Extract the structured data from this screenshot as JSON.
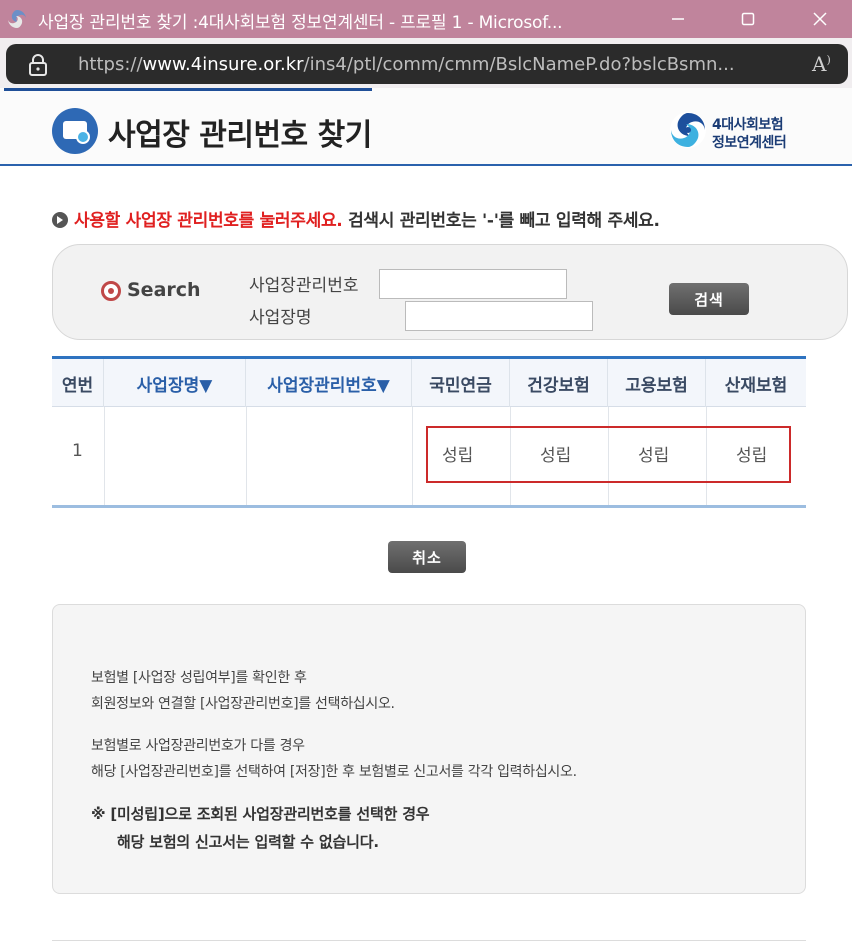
{
  "window": {
    "title": "사업장 관리번호 찾기 :4대사회보험 정보연계센터 - 프로필 1 - Microsof...",
    "url_prefix": "https://",
    "url_domain": "www.4insure.or.kr",
    "url_path": "/ins4/ptl/comm/cmm/BslcNameP.do?bslcBsmn..."
  },
  "header": {
    "page_title": "사업장 관리번호 찾기",
    "brand_line1": "4대사회보험",
    "brand_line2": "정보연계센터"
  },
  "notice": {
    "red_text": "사용할 사업장 관리번호를 눌러주세요.",
    "black_text": " 검색시 관리번호는 '-'를 빼고 입력해 주세요."
  },
  "search": {
    "label": "Search",
    "field1_label": "사업장관리번호",
    "field1_value": "",
    "field2_label": "사업장명",
    "field2_value": "",
    "button_label": "검색"
  },
  "table": {
    "headers": [
      "연번",
      "사업장명▼",
      "사업장관리번호▼",
      "국민연금",
      "건강보험",
      "고용보험",
      "산재보험"
    ],
    "rows": [
      [
        "1",
        "",
        "",
        "성립",
        "성립",
        "성립",
        "성립"
      ]
    ]
  },
  "cancel_label": "취소",
  "info": {
    "line1": "보험별 [사업장 성립여부]를 확인한 후",
    "line2": "회원정보와 연결할 [사업장관리번호]를 선택하십시오.",
    "line3": "보험별로 사업장관리번호가 다를 경우",
    "line4": "해당 [사업장관리번호]를 선택하여 [저장]한 후 보험별로 신고서를 각각 입력하십시오.",
    "warn1": "※ [미성립]으로 조회된 사업장관리번호를 선택한 경우",
    "warn2": "해당 보험의 신고서는 입력할 수 없습니다."
  },
  "colors": {
    "titlebar": "#c0849c",
    "accent_blue": "#2e73c0",
    "notice_red": "#e02020",
    "highlight_red": "#cc2a2a"
  }
}
